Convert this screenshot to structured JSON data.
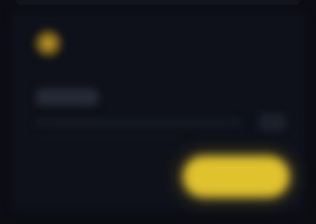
{
  "dialog": {
    "title": "",
    "subtitle": "",
    "section_label": "",
    "row_value": "",
    "row_badge": "",
    "primary_button_label": ""
  },
  "colors": {
    "background": "#0b0d13",
    "card": "#0e1119",
    "accent": "#e0c12e",
    "title": "#c69a2b",
    "muted": "#3a4152"
  },
  "icons": {
    "logo": "coin-logo-icon"
  }
}
